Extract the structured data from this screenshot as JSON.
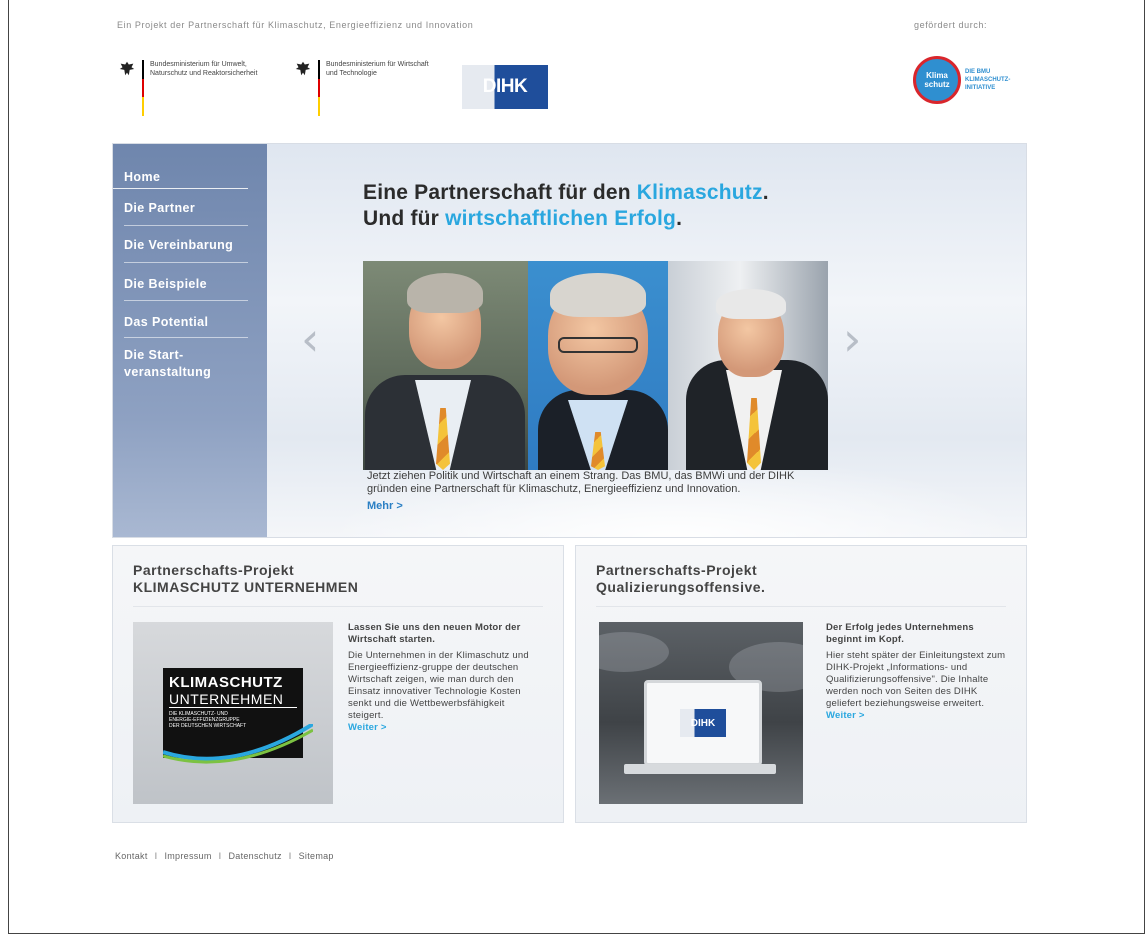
{
  "header": {
    "tagline": "Ein Projekt der Partnerschaft für Klimaschutz, Energieeffizienz und Innovation",
    "supported_by": "gefördert durch:",
    "ministry1": "Bundesministerium für Umwelt, Naturschutz und Reaktorsicherheit",
    "ministry2": "Bundesministerium für Wirtschaft und Technologie",
    "dihk_logo_text": "DIHK",
    "klima_badge": "Klima schutz",
    "klima_text": "DIE BMU KLIMASCHUTZ-INITIATIVE"
  },
  "nav": {
    "items": [
      {
        "label": "Home"
      },
      {
        "label": "Die Partner"
      },
      {
        "label": "Die Vereinbarung"
      },
      {
        "label": "Die Beispiele"
      },
      {
        "label": "Das Potential"
      },
      {
        "label": "Die Start-veranstaltung"
      }
    ]
  },
  "hero": {
    "title_line1_prefix": "Eine Partnerschaft für den ",
    "title_line1_accent": "Klimaschutz",
    "title_line1_suffix": ".",
    "title_line2_prefix": "Und für ",
    "title_line2_accent": "wirtschaftlichen Erfolg",
    "title_line2_suffix": ".",
    "text": "Jetzt ziehen Politik und Wirtschaft an einem Strang. Das BMU, das BMWi und der DIHK gründen eine Partnerschaft für Klimaschutz, Energieeffizienz und Innovation.",
    "more": "Mehr >",
    "arrow_prev": "‹",
    "arrow_next": "›"
  },
  "panel_left": {
    "title_line1": "Partnerschafts-Projekt",
    "title_line2": "KLIMASCHUTZ UNTERNEHMEN",
    "lead": "Lassen Sie uns den neuen Motor der Wirtschaft starten.",
    "body": "Die Unternehmen in der Klimaschutz und Energieeffizienz-gruppe der deutschen Wirtschaft zeigen, wie man durch den Einsatz innovativer Technologie Kosten senkt und die Wettbewerbsfähigkeit steigert.",
    "link": "Weiter >",
    "img_title1": "KLIMASCHUTZ",
    "img_title2": "UNTERNEHMEN",
    "img_sub": "DIE KLIMASCHUTZ- UND ENERGIE-EFFIZIENZGRUPPE DER DEUTSCHEN WIRTSCHAFT"
  },
  "panel_right": {
    "title_line1": "Partnerschafts-Projekt",
    "title_line2": "Qualizierungsoffensive.",
    "lead": "Der Erfolg jedes Unternehmens beginnt im Kopf.",
    "body": "Hier steht später der Einleitungstext zum DIHK-Projekt „Informations- und Qualifizierungsoffensive\". Die Inhalte werden noch von Seiten des DIHK geliefert beziehungsweise erweitert.",
    "link": "Weiter >",
    "img_logo": "DIHK"
  },
  "footer": {
    "links": [
      "Kontakt",
      "Impressum",
      "Datenschutz",
      "Sitemap"
    ],
    "separator": "I"
  },
  "colors": {
    "accent": "#2aa7df",
    "nav_bg": "#7a8fb5",
    "dihk_blue": "#1f4e9b"
  }
}
